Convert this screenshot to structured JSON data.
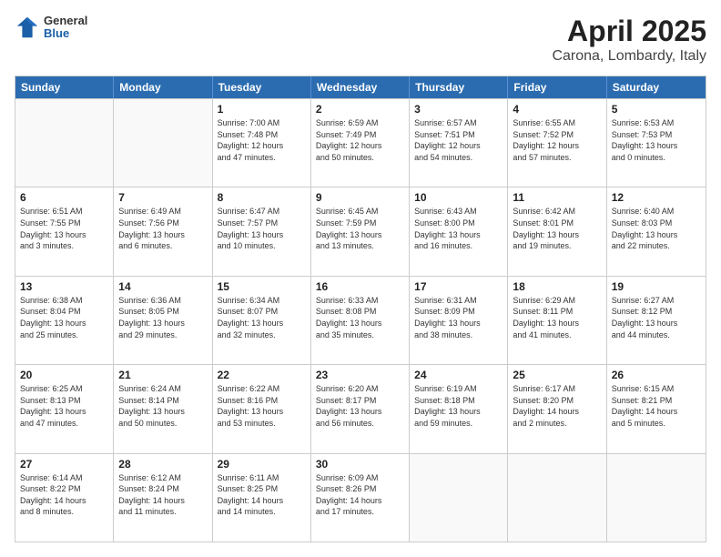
{
  "header": {
    "logo": {
      "general": "General",
      "blue": "Blue"
    },
    "title": "April 2025",
    "subtitle": "Carona, Lombardy, Italy"
  },
  "weekdays": [
    "Sunday",
    "Monday",
    "Tuesday",
    "Wednesday",
    "Thursday",
    "Friday",
    "Saturday"
  ],
  "weeks": [
    [
      {
        "day": "",
        "info": ""
      },
      {
        "day": "",
        "info": ""
      },
      {
        "day": "1",
        "info": "Sunrise: 7:00 AM\nSunset: 7:48 PM\nDaylight: 12 hours\nand 47 minutes."
      },
      {
        "day": "2",
        "info": "Sunrise: 6:59 AM\nSunset: 7:49 PM\nDaylight: 12 hours\nand 50 minutes."
      },
      {
        "day": "3",
        "info": "Sunrise: 6:57 AM\nSunset: 7:51 PM\nDaylight: 12 hours\nand 54 minutes."
      },
      {
        "day": "4",
        "info": "Sunrise: 6:55 AM\nSunset: 7:52 PM\nDaylight: 12 hours\nand 57 minutes."
      },
      {
        "day": "5",
        "info": "Sunrise: 6:53 AM\nSunset: 7:53 PM\nDaylight: 13 hours\nand 0 minutes."
      }
    ],
    [
      {
        "day": "6",
        "info": "Sunrise: 6:51 AM\nSunset: 7:55 PM\nDaylight: 13 hours\nand 3 minutes."
      },
      {
        "day": "7",
        "info": "Sunrise: 6:49 AM\nSunset: 7:56 PM\nDaylight: 13 hours\nand 6 minutes."
      },
      {
        "day": "8",
        "info": "Sunrise: 6:47 AM\nSunset: 7:57 PM\nDaylight: 13 hours\nand 10 minutes."
      },
      {
        "day": "9",
        "info": "Sunrise: 6:45 AM\nSunset: 7:59 PM\nDaylight: 13 hours\nand 13 minutes."
      },
      {
        "day": "10",
        "info": "Sunrise: 6:43 AM\nSunset: 8:00 PM\nDaylight: 13 hours\nand 16 minutes."
      },
      {
        "day": "11",
        "info": "Sunrise: 6:42 AM\nSunset: 8:01 PM\nDaylight: 13 hours\nand 19 minutes."
      },
      {
        "day": "12",
        "info": "Sunrise: 6:40 AM\nSunset: 8:03 PM\nDaylight: 13 hours\nand 22 minutes."
      }
    ],
    [
      {
        "day": "13",
        "info": "Sunrise: 6:38 AM\nSunset: 8:04 PM\nDaylight: 13 hours\nand 25 minutes."
      },
      {
        "day": "14",
        "info": "Sunrise: 6:36 AM\nSunset: 8:05 PM\nDaylight: 13 hours\nand 29 minutes."
      },
      {
        "day": "15",
        "info": "Sunrise: 6:34 AM\nSunset: 8:07 PM\nDaylight: 13 hours\nand 32 minutes."
      },
      {
        "day": "16",
        "info": "Sunrise: 6:33 AM\nSunset: 8:08 PM\nDaylight: 13 hours\nand 35 minutes."
      },
      {
        "day": "17",
        "info": "Sunrise: 6:31 AM\nSunset: 8:09 PM\nDaylight: 13 hours\nand 38 minutes."
      },
      {
        "day": "18",
        "info": "Sunrise: 6:29 AM\nSunset: 8:11 PM\nDaylight: 13 hours\nand 41 minutes."
      },
      {
        "day": "19",
        "info": "Sunrise: 6:27 AM\nSunset: 8:12 PM\nDaylight: 13 hours\nand 44 minutes."
      }
    ],
    [
      {
        "day": "20",
        "info": "Sunrise: 6:25 AM\nSunset: 8:13 PM\nDaylight: 13 hours\nand 47 minutes."
      },
      {
        "day": "21",
        "info": "Sunrise: 6:24 AM\nSunset: 8:14 PM\nDaylight: 13 hours\nand 50 minutes."
      },
      {
        "day": "22",
        "info": "Sunrise: 6:22 AM\nSunset: 8:16 PM\nDaylight: 13 hours\nand 53 minutes."
      },
      {
        "day": "23",
        "info": "Sunrise: 6:20 AM\nSunset: 8:17 PM\nDaylight: 13 hours\nand 56 minutes."
      },
      {
        "day": "24",
        "info": "Sunrise: 6:19 AM\nSunset: 8:18 PM\nDaylight: 13 hours\nand 59 minutes."
      },
      {
        "day": "25",
        "info": "Sunrise: 6:17 AM\nSunset: 8:20 PM\nDaylight: 14 hours\nand 2 minutes."
      },
      {
        "day": "26",
        "info": "Sunrise: 6:15 AM\nSunset: 8:21 PM\nDaylight: 14 hours\nand 5 minutes."
      }
    ],
    [
      {
        "day": "27",
        "info": "Sunrise: 6:14 AM\nSunset: 8:22 PM\nDaylight: 14 hours\nand 8 minutes."
      },
      {
        "day": "28",
        "info": "Sunrise: 6:12 AM\nSunset: 8:24 PM\nDaylight: 14 hours\nand 11 minutes."
      },
      {
        "day": "29",
        "info": "Sunrise: 6:11 AM\nSunset: 8:25 PM\nDaylight: 14 hours\nand 14 minutes."
      },
      {
        "day": "30",
        "info": "Sunrise: 6:09 AM\nSunset: 8:26 PM\nDaylight: 14 hours\nand 17 minutes."
      },
      {
        "day": "",
        "info": ""
      },
      {
        "day": "",
        "info": ""
      },
      {
        "day": "",
        "info": ""
      }
    ]
  ]
}
